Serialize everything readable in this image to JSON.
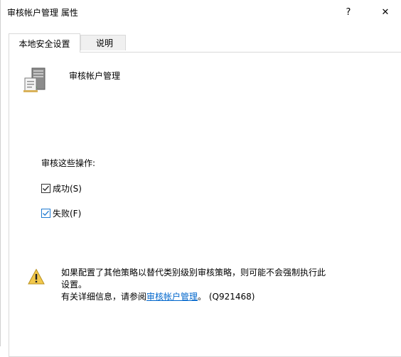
{
  "window": {
    "title": "审核帐户管理 属性",
    "help_label": "?",
    "close_label": "✕"
  },
  "tabs": [
    {
      "label": "本地安全设置"
    },
    {
      "label": "说明"
    }
  ],
  "policy": {
    "icon": "server-policy-icon",
    "name": "审核帐户管理"
  },
  "audit": {
    "label": "审核这些操作:",
    "success_label": "成功(S)",
    "success_checked": true,
    "failure_label": "失败(F)",
    "failure_checked": true
  },
  "note": {
    "icon": "warning-icon",
    "line1": "如果配置了其他策略以替代类别级别审核策略，则可能不会强制执行此",
    "line2": "设置。",
    "line3_prefix": "有关详细信息，请参阅",
    "link_text": "审核帐户管理",
    "line3_suffix": "。 (Q921468)"
  },
  "colors": {
    "link": "#0066cc",
    "focus_border": "#1e7ad1",
    "warning_fill": "#f2c84b"
  }
}
